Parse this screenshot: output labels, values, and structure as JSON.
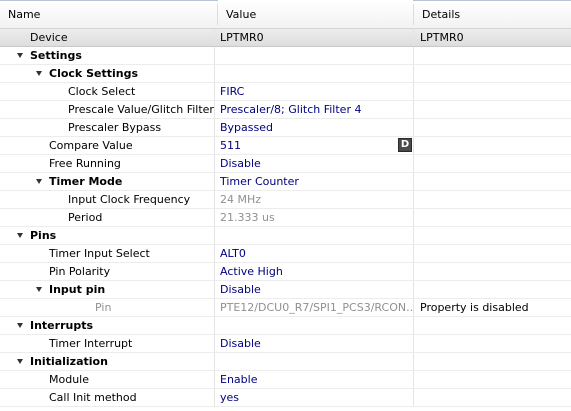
{
  "columns": {
    "name": "Name",
    "value": "Value",
    "details": "Details"
  },
  "device": {
    "name": "Device",
    "value": "LPTMR0",
    "details": "LPTMR0"
  },
  "rows": [
    {
      "name": "Settings",
      "value": "",
      "details": "",
      "group": true
    },
    {
      "name": "Clock Settings",
      "value": "",
      "details": "",
      "group": true
    },
    {
      "name": "Clock Select",
      "value": "FIRC",
      "details": ""
    },
    {
      "name": "Prescale Value/Glitch Filter",
      "value": "Prescaler/8; Glitch Filter 4",
      "details": ""
    },
    {
      "name": "Prescaler Bypass",
      "value": "Bypassed",
      "details": ""
    },
    {
      "name": "Compare Value",
      "value": "511",
      "details": "",
      "button": "D"
    },
    {
      "name": "Free Running",
      "value": "Disable",
      "details": ""
    },
    {
      "name": "Timer Mode",
      "value": "Timer Counter",
      "details": "",
      "group": true
    },
    {
      "name": "Input Clock Frequency",
      "value": "24 MHz",
      "details": "",
      "disabled": true
    },
    {
      "name": "Period",
      "value": "21.333 us",
      "details": "",
      "disabled": true
    },
    {
      "name": "Pins",
      "value": "",
      "details": "",
      "group": true
    },
    {
      "name": "Timer Input Select",
      "value": "ALT0",
      "details": ""
    },
    {
      "name": "Pin Polarity",
      "value": "Active High",
      "details": ""
    },
    {
      "name": "Input pin",
      "value": "Disable",
      "details": "",
      "group": true
    },
    {
      "name": "Pin",
      "value": "PTE12/DCU0_R7/SPI1_PCS3/RCON...",
      "details": "Property is disabled",
      "disabled": true
    },
    {
      "name": "Interrupts",
      "value": "",
      "details": "",
      "group": true
    },
    {
      "name": "Timer Interrupt",
      "value": "Disable",
      "details": ""
    },
    {
      "name": "Initialization",
      "value": "",
      "details": "",
      "group": true
    },
    {
      "name": "Module",
      "value": "Enable",
      "details": ""
    },
    {
      "name": "Call Init method",
      "value": "yes",
      "details": ""
    }
  ]
}
